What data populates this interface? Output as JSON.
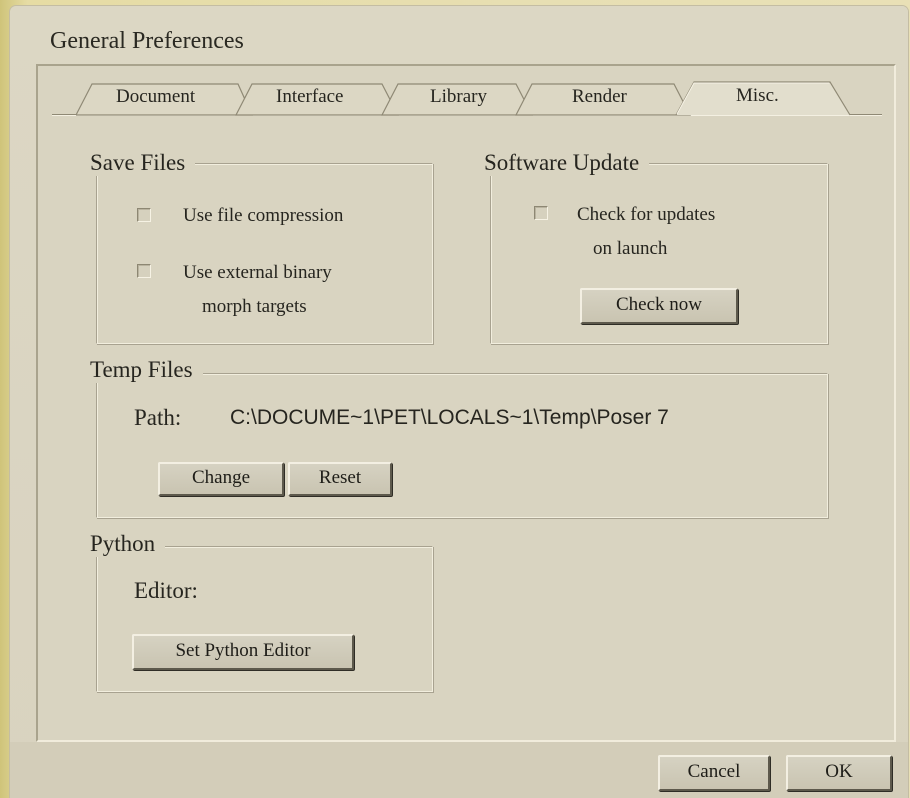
{
  "window": {
    "title": "General Preferences"
  },
  "tabs": [
    {
      "label": "Document",
      "active": false
    },
    {
      "label": "Interface",
      "active": false
    },
    {
      "label": "Library",
      "active": false
    },
    {
      "label": "Render",
      "active": false
    },
    {
      "label": "Misc.",
      "active": true
    }
  ],
  "save_files": {
    "heading": "Save Files",
    "compression": {
      "label": "Use file compression",
      "checked": false
    },
    "binary_morph": {
      "label_line1": "Use external binary",
      "label_line2": "morph targets",
      "checked": false
    }
  },
  "software_update": {
    "heading": "Software Update",
    "check_updates": {
      "label_line1": "Check for updates",
      "label_line2": "on launch",
      "checked": false
    },
    "check_now_label": "Check now"
  },
  "temp_files": {
    "heading": "Temp Files",
    "path_label": "Path:",
    "path_value": "C:\\DOCUME~1\\PET\\LOCALS~1\\Temp\\Poser 7",
    "change_label": "Change",
    "reset_label": "Reset"
  },
  "python": {
    "heading": "Python",
    "editor_label": "Editor:",
    "set_editor_label": "Set Python Editor"
  },
  "footer": {
    "cancel_label": "Cancel",
    "ok_label": "OK"
  }
}
